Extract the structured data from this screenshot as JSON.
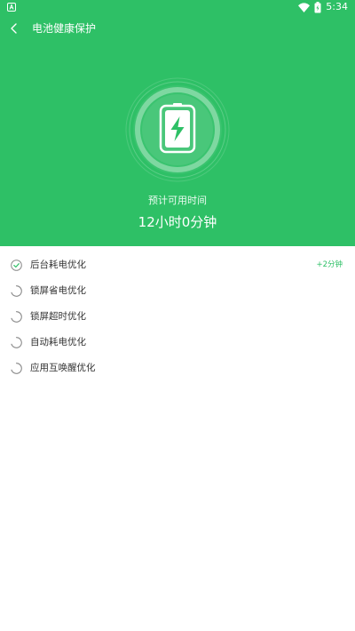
{
  "status_bar": {
    "time": "5:34",
    "icons": [
      "notification-a-icon",
      "wifi-icon",
      "battery-charging-icon"
    ]
  },
  "header": {
    "title": "电池健康保护",
    "back_icon": "chevron-left-icon"
  },
  "summary": {
    "label": "预计可用时间",
    "value": "12小时0分钟",
    "graphic_icon": "battery-charging-icon"
  },
  "tasks": [
    {
      "label": "后台耗电优化",
      "status": "done",
      "gain": "+2分钟"
    },
    {
      "label": "锁屏省电优化",
      "status": "running",
      "gain": ""
    },
    {
      "label": "锁屏超时优化",
      "status": "running",
      "gain": ""
    },
    {
      "label": "自动耗电优化",
      "status": "running",
      "gain": ""
    },
    {
      "label": "应用互唤醒优化",
      "status": "running",
      "gain": ""
    }
  ],
  "colors": {
    "brand": "#2ec066",
    "background": "#ffffff",
    "text": "#333333",
    "check": "#2ec066",
    "spinner": "#8a8a8a"
  }
}
